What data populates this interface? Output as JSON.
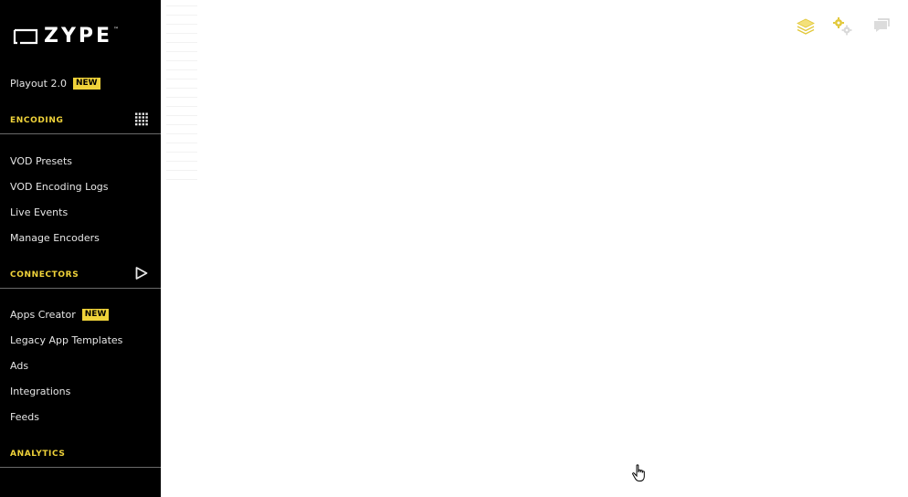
{
  "logo": {
    "text": "ZYPE",
    "tm": "™"
  },
  "sidebar": {
    "playout": {
      "label": "Playout 2.0",
      "badge": "NEW"
    },
    "sections": {
      "encoding": {
        "title": "ENCODING",
        "icon": "grid-icon"
      },
      "connectors": {
        "title": "CONNECTORS",
        "icon": "play-outline-icon"
      },
      "analytics": {
        "title": "ANALYTICS"
      }
    },
    "encoding_items": [
      "VOD Presets",
      "VOD Encoding Logs",
      "Live Events",
      "Manage Encoders"
    ],
    "connectors_items": [
      {
        "label": "Apps Creator",
        "badge": "NEW"
      },
      {
        "label": "Legacy App Templates"
      },
      {
        "label": "Ads"
      },
      {
        "label": "Integrations"
      },
      {
        "label": "Feeds"
      }
    ]
  },
  "header_icons": [
    "layers-icon",
    "gears-icon",
    "chat-icon"
  ],
  "colors": {
    "sidebar_bg": "#000000",
    "accent": "#f0d33a",
    "text": "#e6e6e6"
  }
}
